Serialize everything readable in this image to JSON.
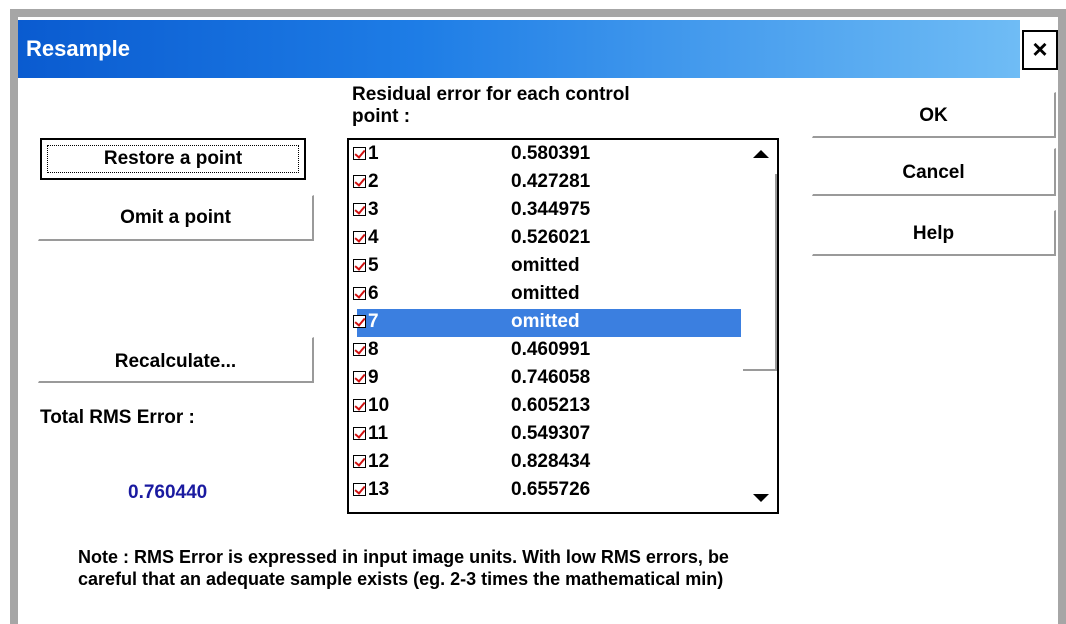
{
  "window": {
    "title": "Resample",
    "close_glyph": "×"
  },
  "buttons": {
    "restore": "Restore a point",
    "omit": "Omit a point",
    "recalculate": "Recalculate...",
    "ok": "OK",
    "cancel": "Cancel",
    "help": "Help"
  },
  "residual_label_line1": "Residual error for each control",
  "residual_label_line2": "point :",
  "rms": {
    "label": "Total RMS Error :",
    "value": "0.760440"
  },
  "list": {
    "rows": [
      {
        "num": "1",
        "value": "0.580391",
        "checked": true,
        "selected": false
      },
      {
        "num": "2",
        "value": "0.427281",
        "checked": true,
        "selected": false
      },
      {
        "num": "3",
        "value": "0.344975",
        "checked": true,
        "selected": false
      },
      {
        "num": "4",
        "value": "0.526021",
        "checked": true,
        "selected": false
      },
      {
        "num": "5",
        "value": "omitted",
        "checked": true,
        "selected": false
      },
      {
        "num": "6",
        "value": "omitted",
        "checked": true,
        "selected": false
      },
      {
        "num": "7",
        "value": "omitted",
        "checked": true,
        "selected": true
      },
      {
        "num": "8",
        "value": "0.460991",
        "checked": true,
        "selected": false
      },
      {
        "num": "9",
        "value": "0.746058",
        "checked": true,
        "selected": false
      },
      {
        "num": "10",
        "value": "0.605213",
        "checked": true,
        "selected": false
      },
      {
        "num": "11",
        "value": "0.549307",
        "checked": true,
        "selected": false
      },
      {
        "num": "12",
        "value": "0.828434",
        "checked": true,
        "selected": false
      },
      {
        "num": "13",
        "value": "0.655726",
        "checked": true,
        "selected": false
      }
    ]
  },
  "note": {
    "line1": "Note : RMS Error is expressed in input image units. With low RMS errors, be",
    "line2": "careful that an adequate sample exists (eg. 2-3 times the mathematical min)"
  },
  "icons": {
    "close": "close-icon",
    "checkbox": "checkbox-icon",
    "scroll_up": "arrow-up-icon",
    "scroll_down": "arrow-down-icon"
  },
  "colors": {
    "title_start": "#0a5bd0",
    "title_end": "#6fbcf5",
    "selection": "#3b7fe0",
    "rms_value": "#1a1aa0",
    "check": "#d01010"
  }
}
